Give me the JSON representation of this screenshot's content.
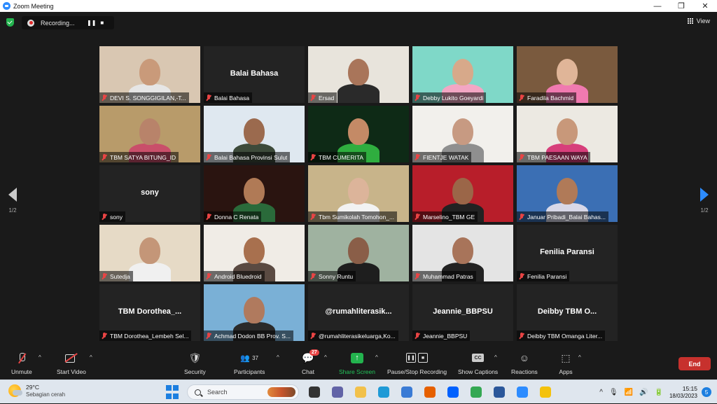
{
  "window": {
    "title": "Zoom Meeting",
    "controls": [
      "—",
      "❐",
      "✕"
    ]
  },
  "topbar": {
    "recording_label": "Recording...",
    "pause_glyph": "❚❚",
    "stop_glyph": "■",
    "view_label": "View"
  },
  "gallery": {
    "tiles": [
      {
        "name": "DEVI S. SONGGIGILAN,-T...",
        "video": true,
        "bg": "#d9c7b2",
        "skin": "#c99a7a",
        "shirt": "#e6e6e6"
      },
      {
        "name": "Balai Bahasa",
        "display_name": "Balai Bahasa",
        "video": false
      },
      {
        "name": "Ersad",
        "video": true,
        "bg": "#e8e4dc",
        "skin": "#a9755a",
        "shirt": "#2a2a2a"
      },
      {
        "name": "Debby Lukito Goeyardi",
        "video": true,
        "bg": "#7fd8c8",
        "skin": "#d7a98a",
        "shirt": "#f3a6c4"
      },
      {
        "name": "Faradila Bachmid",
        "video": true,
        "bg": "#7a5a3e",
        "skin": "#e0b598",
        "shirt": "#f07ab0"
      },
      {
        "name": "TBM SATYA BITUNG_ID",
        "video": true,
        "bg": "#b89b6a",
        "skin": "#b8836a",
        "shirt": "#c94f6a"
      },
      {
        "name": "Balai Bahasa Provinsi Sulut",
        "video": true,
        "bg": "#dfe8f0",
        "skin": "#9b6a4e",
        "shirt": "#3d4a3a",
        "active": true
      },
      {
        "name": "TBM CUMERITA",
        "video": true,
        "bg": "#0e2a16",
        "skin": "#c48a66",
        "shirt": "#2fae3f"
      },
      {
        "name": "FIENTJE WATAK",
        "video": true,
        "bg": "#f2f0ec",
        "skin": "#c79a82",
        "shirt": "#8f8f8f"
      },
      {
        "name": "TBM PAESAAN WAYA",
        "video": true,
        "bg": "#ece9e2",
        "skin": "#c8987a",
        "shirt": "#d73f7b"
      },
      {
        "name": "sony",
        "display_name": "sony",
        "video": false
      },
      {
        "name": "Donna C Renata",
        "video": true,
        "bg": "#2a1410",
        "skin": "#b07a56",
        "shirt": "#2a6a3a"
      },
      {
        "name": "Tbm Sumikolah Tomohon_...",
        "video": true,
        "bg": "#c8b48a",
        "skin": "#dcb49a",
        "shirt": "#f2f2f2"
      },
      {
        "name": "Marselino_TBM GE",
        "video": true,
        "bg": "#b81e2a",
        "skin": "#9b6648",
        "shirt": "#222222"
      },
      {
        "name": "Januar Pribadi_Balai Bahas...",
        "video": true,
        "bg": "#3b6fb4",
        "skin": "#b07a58",
        "shirt": "#d8d8e8"
      },
      {
        "name": "Sutedja",
        "video": true,
        "bg": "#e6dac6",
        "skin": "#c49678",
        "shirt": "#f0f0f0"
      },
      {
        "name": "Android Bluedroid",
        "video": true,
        "bg": "#f0ece6",
        "skin": "#a8704e",
        "shirt": "#5a4a42"
      },
      {
        "name": "Sonny Runtu",
        "video": true,
        "bg": "#9fb2a0",
        "skin": "#8a5e48",
        "shirt": "#1e1e1e"
      },
      {
        "name": "Muhammad Patras",
        "video": true,
        "bg": "#e4e4e4",
        "skin": "#a8745a",
        "shirt": "#222222"
      },
      {
        "name": "Fenilia Paransi",
        "display_name": "Fenilia Paransi",
        "video": false
      },
      {
        "name": "TBM Dorothea_Lembeh Sel...",
        "display_name": "TBM  Dorothea_...",
        "video": false
      },
      {
        "name": "Achmad Dodon BB Prov. S...",
        "video": true,
        "bg": "#7ab0d6",
        "skin": "#b07a5e",
        "shirt": "#2a2a2a"
      },
      {
        "name": "@rumahliterasikeluarga,Ko...",
        "display_name": "@rumahliterasik...",
        "video": false
      },
      {
        "name": "Jeannie_BBPSU",
        "display_name": "Jeannie_BBPSU",
        "video": false
      },
      {
        "name": "Deibby TBM Omanga Liter...",
        "display_name": "Deibby TBM O...",
        "video": false
      }
    ],
    "page": "1/2"
  },
  "toolbar": {
    "unmute": "Unmute",
    "start_video": "Start Video",
    "security": "Security",
    "participants": "Participants",
    "participants_count": "37",
    "chat": "Chat",
    "chat_badge": "27",
    "share_screen": "Share Screen",
    "pause_stop_recording": "Pause/Stop Recording",
    "show_captions": "Show Captions",
    "captions_glyph": "CC",
    "reactions": "Reactions",
    "apps": "Apps",
    "end": "End",
    "caret_glyph": "^"
  },
  "taskbar": {
    "weather_temp": "29°C",
    "weather_desc": "Sebagian cerah",
    "search_label": "Search",
    "time": "15:15",
    "date": "18/03/2023",
    "notification_count": "5",
    "tray_caret_glyph": "^",
    "apps": [
      {
        "name": "task-view-icon",
        "color": "#333333"
      },
      {
        "name": "teams-chat-icon",
        "color": "#6264a7"
      },
      {
        "name": "file-explorer-icon",
        "color": "#f2c14b"
      },
      {
        "name": "edge-icon",
        "color": "#1f9ad6"
      },
      {
        "name": "store-icon",
        "color": "#3a7bd5"
      },
      {
        "name": "firefox-icon",
        "color": "#e66000"
      },
      {
        "name": "dropbox-icon",
        "color": "#0061fe"
      },
      {
        "name": "chrome-icon",
        "color": "#34a853"
      },
      {
        "name": "word-icon",
        "color": "#2b579a"
      },
      {
        "name": "zoom-icon",
        "color": "#2d8cff"
      },
      {
        "name": "greenshot-icon",
        "color": "#f4c20d"
      }
    ]
  }
}
